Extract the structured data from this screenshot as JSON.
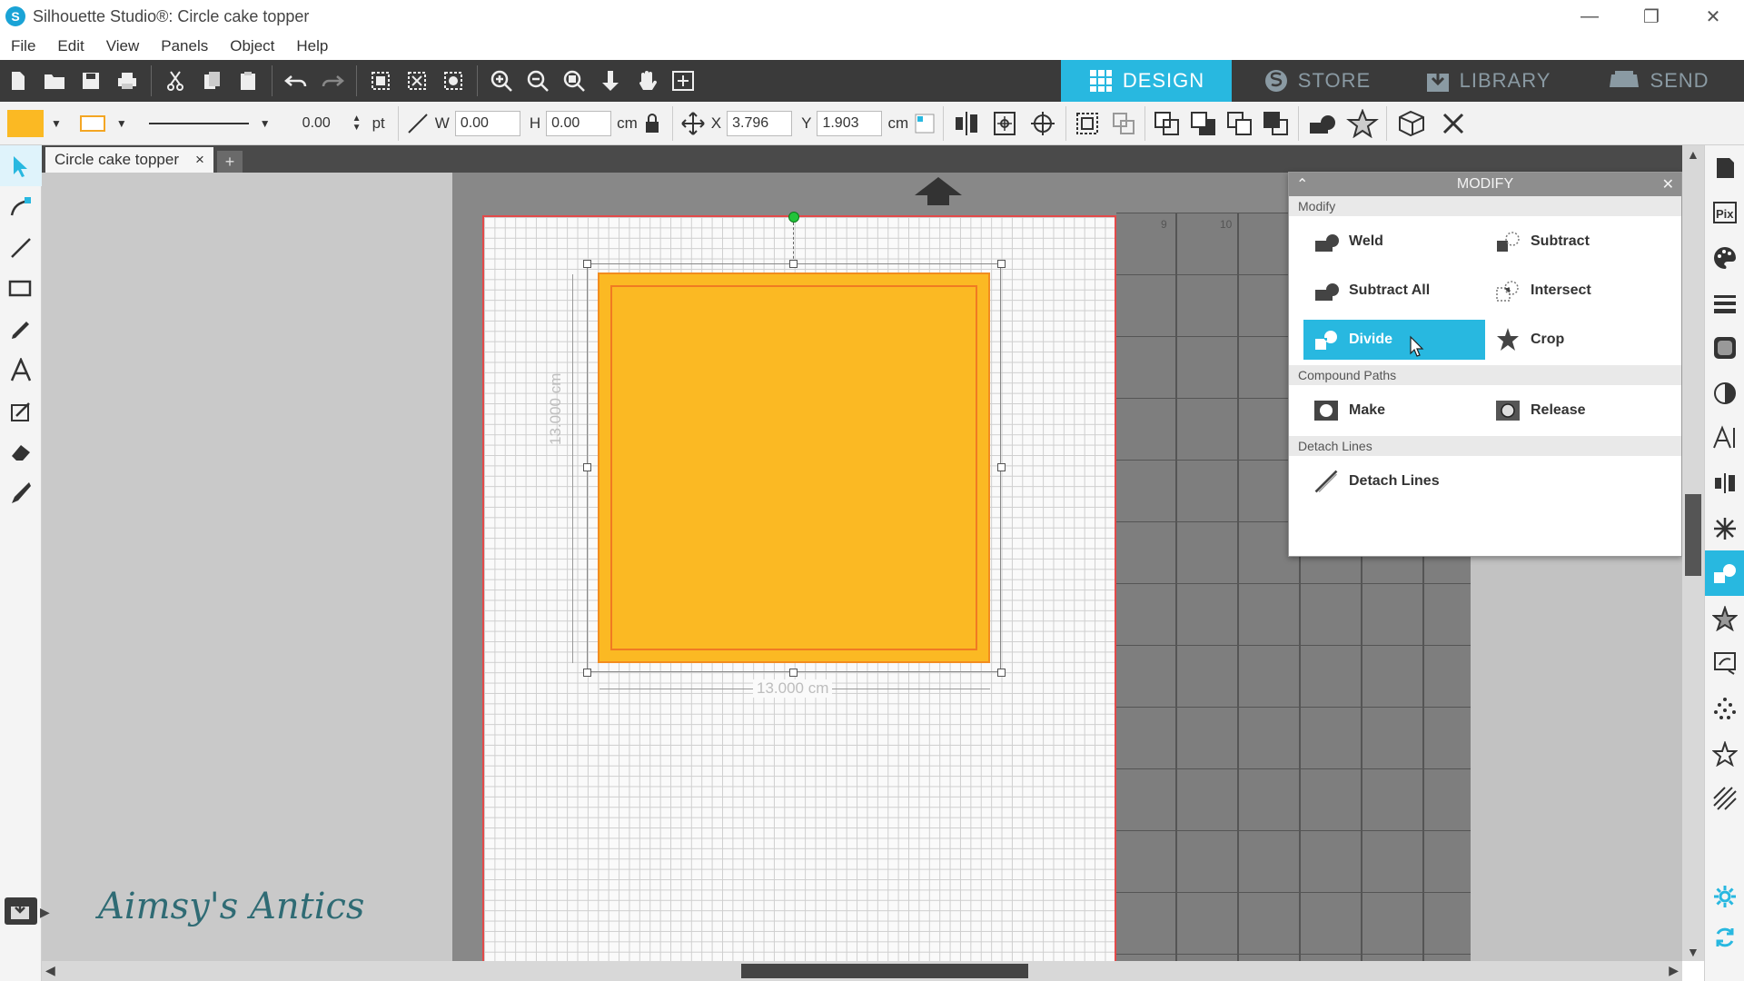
{
  "window": {
    "title": "Silhouette Studio®: Circle cake topper",
    "app_logo": "S"
  },
  "menu": [
    "File",
    "Edit",
    "View",
    "Panels",
    "Object",
    "Help"
  ],
  "mode_tabs": [
    {
      "label": "DESIGN",
      "active": true
    },
    {
      "label": "STORE",
      "active": false
    },
    {
      "label": "LIBRARY",
      "active": false
    },
    {
      "label": "SEND",
      "active": false
    }
  ],
  "props": {
    "fill_color": "#fbb923",
    "line_width": "0.00",
    "line_unit": "pt",
    "w_label": "W",
    "w_value": "0.00",
    "h_label": "H",
    "h_value": "0.00",
    "size_unit": "cm",
    "x_label": "X",
    "x_value": "3.796",
    "y_label": "Y",
    "y_value": "1.903",
    "pos_unit": "cm"
  },
  "document": {
    "tab_name": "Circle cake topper",
    "close": "×",
    "add": "+"
  },
  "canvas": {
    "width_label": "13.000 cm",
    "height_label": "13.000 cm",
    "ruler_9": "9",
    "ruler_10": "10"
  },
  "modify_panel": {
    "title": "MODIFY",
    "section_modify": "Modify",
    "weld": "Weld",
    "subtract": "Subtract",
    "subtract_all": "Subtract All",
    "intersect": "Intersect",
    "divide": "Divide",
    "crop": "Crop",
    "section_compound": "Compound Paths",
    "make": "Make",
    "release": "Release",
    "section_detach": "Detach Lines",
    "detach_lines": "Detach Lines",
    "active_button": "Divide"
  },
  "watermark": "Aimsy's Antics",
  "colors": {
    "accent": "#28b8e0",
    "shape_fill": "#fbb923",
    "shape_stroke": "#f07a22",
    "mat_border": "#e34a4a"
  }
}
